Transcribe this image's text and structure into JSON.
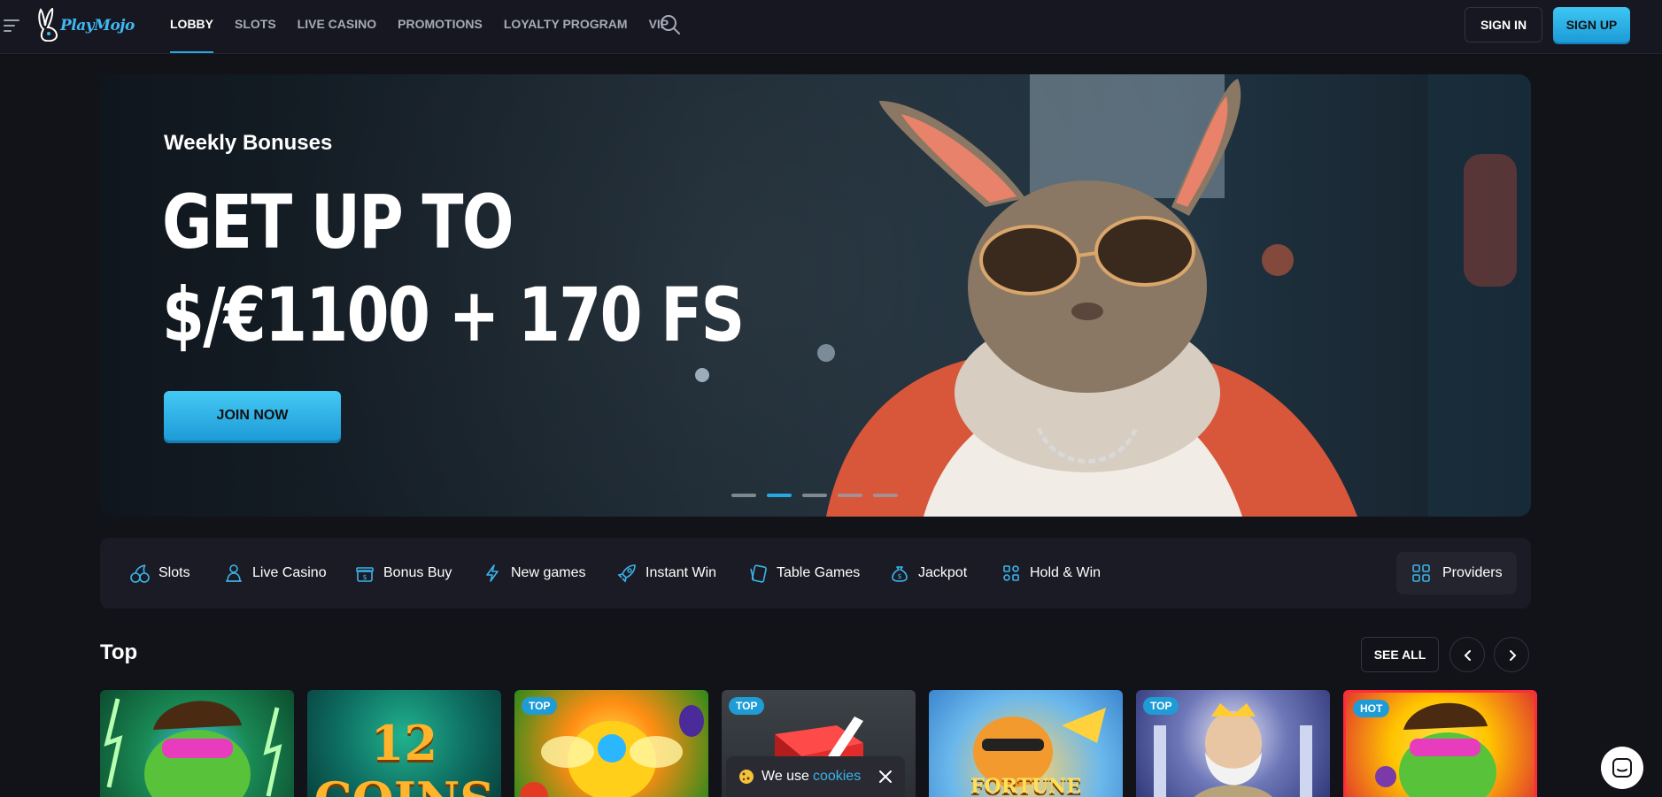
{
  "brand": {
    "name": "PlayMojo"
  },
  "nav": {
    "items": [
      {
        "label": "LOBBY",
        "active": true
      },
      {
        "label": "SLOTS",
        "active": false
      },
      {
        "label": "LIVE CASINO",
        "active": false
      },
      {
        "label": "PROMOTIONS",
        "active": false
      },
      {
        "label": "LOYALTY PROGRAM",
        "active": false
      },
      {
        "label": "VIP",
        "active": false
      }
    ],
    "sign_in": "SIGN IN",
    "sign_up": "SIGN UP"
  },
  "hero": {
    "subtitle": "Weekly Bonuses",
    "title_line1": "GET UP TO",
    "title_line2": "$/€1100 + 170 FS",
    "cta": "JOIN NOW",
    "slides_total": 5,
    "active_slide": 2
  },
  "categories": {
    "items": [
      {
        "label": "Slots",
        "icon": "cherries-icon"
      },
      {
        "label": "Live Casino",
        "icon": "dealer-icon"
      },
      {
        "label": "Bonus Buy",
        "icon": "gift-icon"
      },
      {
        "label": "New games",
        "icon": "lightning-icon"
      },
      {
        "label": "Instant Win",
        "icon": "rocket-icon"
      },
      {
        "label": "Table Games",
        "icon": "cards-icon"
      },
      {
        "label": "Jackpot",
        "icon": "money-bag-icon"
      },
      {
        "label": "Hold & Win",
        "icon": "grid-dots-icon"
      }
    ],
    "providers": "Providers"
  },
  "top_section": {
    "title": "Top",
    "see_all": "SEE ALL",
    "tiles": [
      {
        "badge": ""
      },
      {
        "badge": "",
        "text": "12 COINS"
      },
      {
        "badge": "TOP"
      },
      {
        "badge": "TOP"
      },
      {
        "badge": "",
        "text": "FORTUNE"
      },
      {
        "badge": "TOP"
      },
      {
        "badge": "HOT"
      }
    ]
  },
  "cookie": {
    "text": "We use",
    "link": "cookies"
  },
  "colors": {
    "accent": "#27a8e0",
    "background": "#121219",
    "panel": "#1b1b25"
  }
}
